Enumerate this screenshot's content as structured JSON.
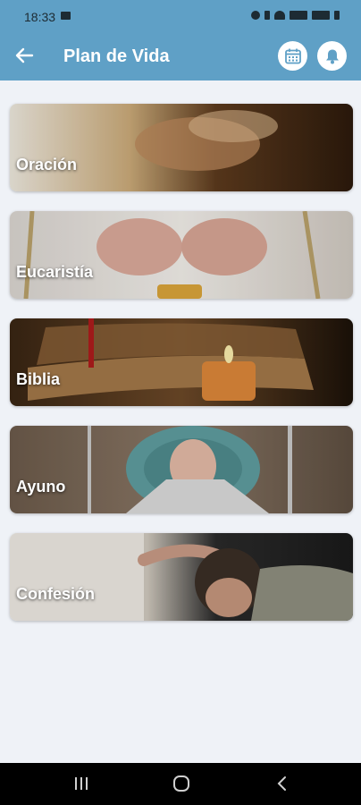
{
  "status_bar": {
    "time": "18:33",
    "icons": [
      "gallery-icon",
      "alarm-icon",
      "bluetooth-icon",
      "wifi-icon",
      "signal-icon",
      "signal-icon",
      "battery-icon"
    ]
  },
  "header": {
    "title": "Plan de Vida",
    "back_icon": "arrow-left-icon",
    "actions": [
      {
        "icon": "calendar-icon"
      },
      {
        "icon": "bell-icon"
      }
    ]
  },
  "cards": [
    {
      "label": "Oración"
    },
    {
      "label": "Eucaristía"
    },
    {
      "label": "Biblia"
    },
    {
      "label": "Ayuno"
    },
    {
      "label": "Confesión"
    }
  ],
  "nav_bar": {
    "buttons": [
      "recents-icon",
      "home-icon",
      "back-icon"
    ]
  },
  "colors": {
    "app_bar": "#5fa0c6",
    "background": "#eff2f7"
  }
}
